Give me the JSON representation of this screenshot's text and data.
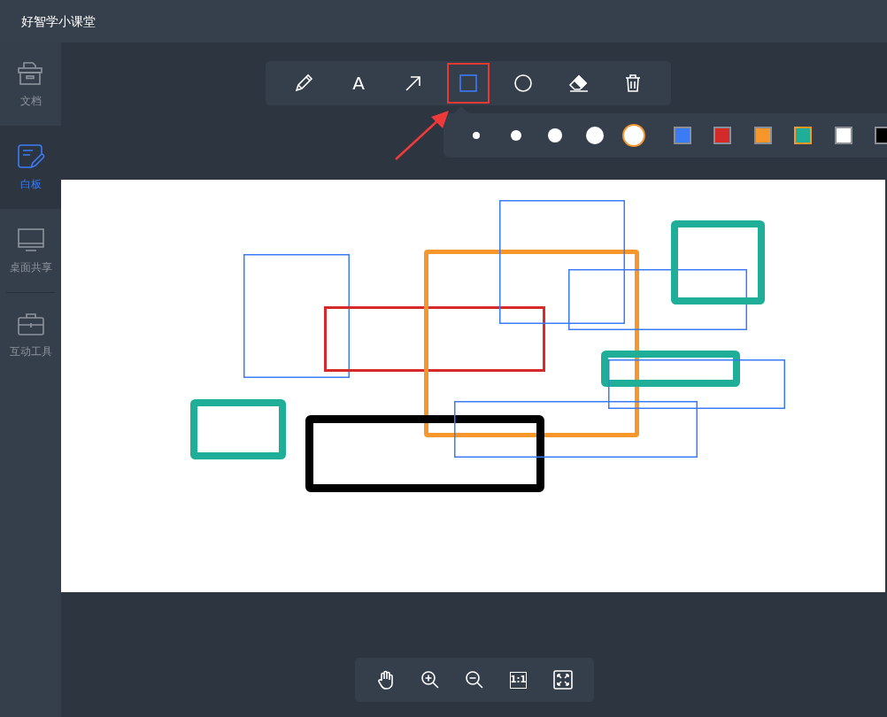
{
  "app": {
    "title": "好智学小课堂"
  },
  "sidebar": {
    "items": [
      {
        "label": "文档",
        "kind": "docs",
        "selected": false
      },
      {
        "label": "白板",
        "kind": "whiteboard",
        "selected": true
      },
      {
        "label": "桌面共享",
        "kind": "screen",
        "selected": false
      },
      {
        "label": "互动工具",
        "kind": "toolbox",
        "selected": false
      }
    ]
  },
  "toolbar": {
    "tools": [
      {
        "kind": "pencil",
        "selected": false
      },
      {
        "kind": "text",
        "label": "A",
        "selected": false
      },
      {
        "kind": "arrow",
        "selected": false
      },
      {
        "kind": "rectangle",
        "selected": true
      },
      {
        "kind": "circle",
        "selected": false
      },
      {
        "kind": "eraser",
        "selected": false
      },
      {
        "kind": "trash",
        "selected": false
      }
    ]
  },
  "style_panel": {
    "sizes": [
      {
        "selected": false
      },
      {
        "selected": false
      },
      {
        "selected": false
      },
      {
        "selected": false
      },
      {
        "selected": true
      }
    ],
    "colors": [
      {
        "color": "#3b7cf6",
        "selected": false
      },
      {
        "color": "#d42a2a",
        "selected": false
      },
      {
        "color": "#f7962a",
        "selected": false
      },
      {
        "color": "#1fae98",
        "selected": true
      },
      {
        "color": "#ffffff",
        "selected": false
      },
      {
        "color": "#000000",
        "selected": false
      }
    ]
  },
  "canvas": {
    "shapes": [
      {
        "kind": "rectangle",
        "color": "#3b7cf6"
      },
      {
        "kind": "rectangle",
        "color": "#d42a2a"
      },
      {
        "kind": "rectangle",
        "color": "#f7962a"
      },
      {
        "kind": "rectangle",
        "color": "#3b7cf6"
      },
      {
        "kind": "rectangle",
        "color": "#3b7cf6"
      },
      {
        "kind": "rectangle",
        "color": "#1fae98"
      },
      {
        "kind": "rectangle",
        "color": "#1fae98"
      },
      {
        "kind": "rectangle",
        "color": "#3b7cf6"
      },
      {
        "kind": "rectangle",
        "color": "#1fae98"
      },
      {
        "kind": "rectangle",
        "color": "#000000"
      },
      {
        "kind": "rectangle",
        "color": "#3b7cf6"
      }
    ]
  },
  "zoom_bar": {
    "tools": [
      {
        "kind": "hand"
      },
      {
        "kind": "zoom_in"
      },
      {
        "kind": "zoom_out"
      },
      {
        "kind": "actual_size",
        "label": "1:1"
      },
      {
        "kind": "fit"
      }
    ]
  }
}
